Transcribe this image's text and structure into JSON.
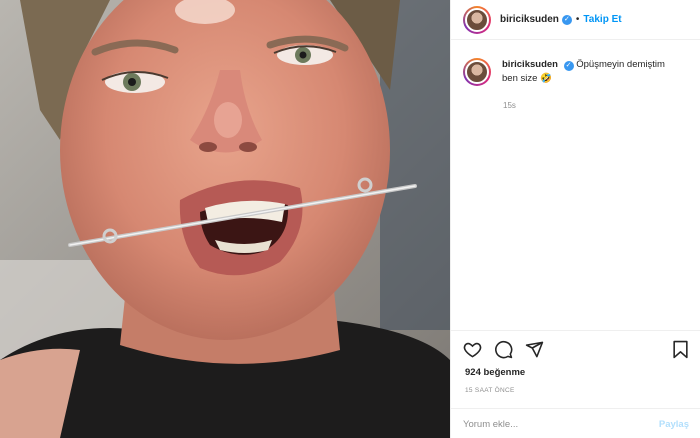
{
  "post": {
    "username": "biriciksuden",
    "follow_label": "Takip Et",
    "separator": "•"
  },
  "caption": {
    "username": "biriciksuden",
    "text": "Öpüşmeyin demiştim ben size 🤣",
    "time": "15s"
  },
  "engagement": {
    "likes": "924 beğenme",
    "posted": "15 SAAT ÖNCE"
  },
  "comment": {
    "placeholder": "Yorum ekle...",
    "submit_label": "Paylaş"
  },
  "icons": {
    "like": "heart-icon",
    "comment": "comment-icon",
    "share": "send-icon",
    "save": "bookmark-icon",
    "verified": "verified-badge-icon"
  },
  "colors": {
    "follow": "#0095f6",
    "verified": "#3897f0",
    "muted": "#8e8e8e",
    "submit_disabled": "#b2dffc"
  }
}
